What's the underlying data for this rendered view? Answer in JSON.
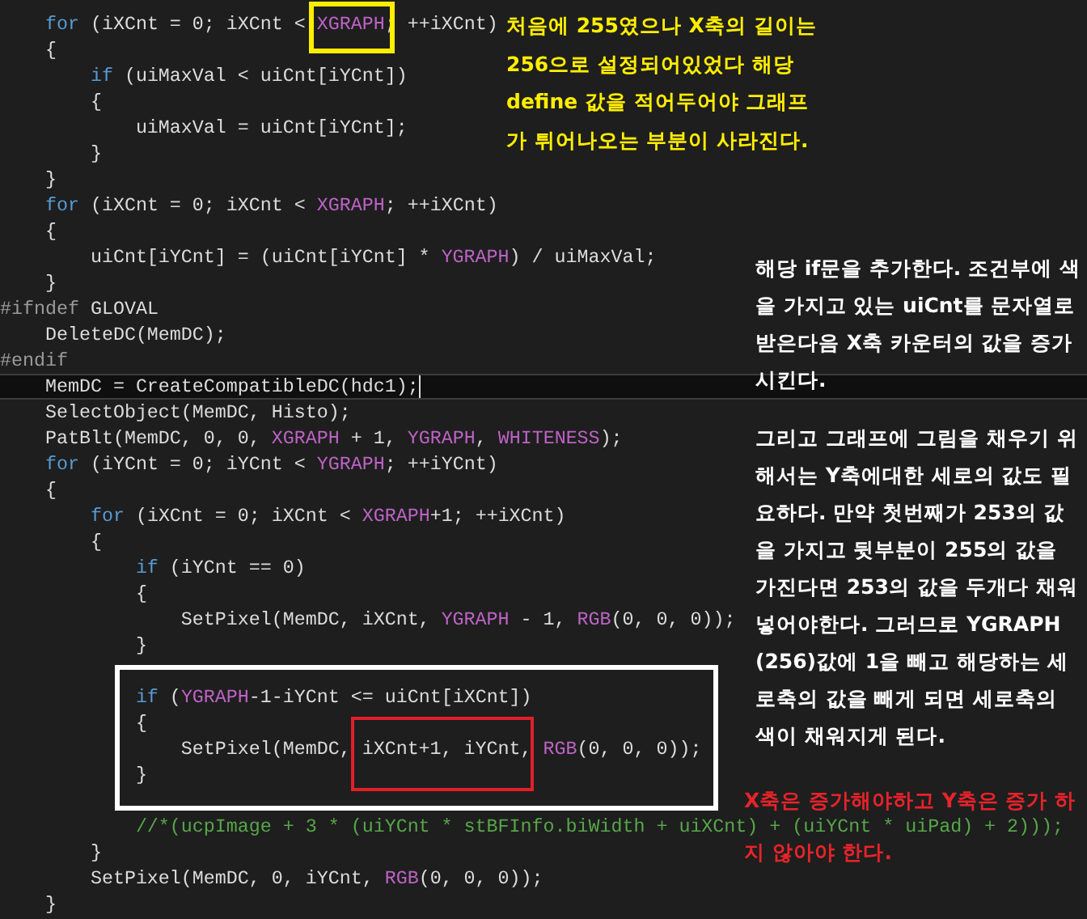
{
  "code_lines": [
    {
      "current": false,
      "tokens": [
        {
          "text": "    for",
          "kind": "keyword"
        },
        {
          "text": " (iXCnt = 0; iXCnt < ",
          "kind": "plain"
        },
        {
          "text": "XGRAPH",
          "kind": "macro"
        },
        {
          "text": "; ++iXCnt)",
          "kind": "plain"
        }
      ]
    },
    {
      "current": false,
      "tokens": [
        {
          "text": "    {",
          "kind": "plain"
        }
      ]
    },
    {
      "current": false,
      "tokens": [
        {
          "text": "        if",
          "kind": "keyword"
        },
        {
          "text": " (uiMaxVal < uiCnt[iYCnt])",
          "kind": "plain"
        }
      ]
    },
    {
      "current": false,
      "tokens": [
        {
          "text": "        {",
          "kind": "plain"
        }
      ]
    },
    {
      "current": false,
      "tokens": [
        {
          "text": "            uiMaxVal = uiCnt[iYCnt];",
          "kind": "plain"
        }
      ]
    },
    {
      "current": false,
      "tokens": [
        {
          "text": "        }",
          "kind": "plain"
        }
      ]
    },
    {
      "current": false,
      "tokens": [
        {
          "text": "    }",
          "kind": "plain"
        }
      ]
    },
    {
      "current": false,
      "tokens": [
        {
          "text": "    for",
          "kind": "keyword"
        },
        {
          "text": " (iXCnt = 0; iXCnt < ",
          "kind": "plain"
        },
        {
          "text": "XGRAPH",
          "kind": "macro"
        },
        {
          "text": "; ++iXCnt)",
          "kind": "plain"
        }
      ]
    },
    {
      "current": false,
      "tokens": [
        {
          "text": "    {",
          "kind": "plain"
        }
      ]
    },
    {
      "current": false,
      "tokens": [
        {
          "text": "        uiCnt[iYCnt] = (uiCnt[iYCnt] * ",
          "kind": "plain"
        },
        {
          "text": "YGRAPH",
          "kind": "macro"
        },
        {
          "text": ") / uiMaxVal;",
          "kind": "plain"
        }
      ]
    },
    {
      "current": false,
      "tokens": [
        {
          "text": "    }",
          "kind": "plain"
        }
      ]
    },
    {
      "current": false,
      "tokens": [
        {
          "text": "#ifndef",
          "kind": "preproc"
        },
        {
          "text": " GLOVAL",
          "kind": "plain"
        }
      ]
    },
    {
      "current": false,
      "tokens": [
        {
          "text": "    DeleteDC(MemDC);",
          "kind": "plain"
        }
      ]
    },
    {
      "current": false,
      "tokens": [
        {
          "text": "#endif",
          "kind": "preproc"
        }
      ]
    },
    {
      "current": true,
      "tokens": [
        {
          "text": "    MemDC = CreateCompatibleDC(hdc1);",
          "kind": "plain"
        }
      ]
    },
    {
      "current": false,
      "tokens": [
        {
          "text": "    SelectObject(MemDC, Histo);",
          "kind": "plain"
        }
      ]
    },
    {
      "current": false,
      "tokens": [
        {
          "text": "    PatBlt(MemDC, 0, 0, ",
          "kind": "plain"
        },
        {
          "text": "XGRAPH",
          "kind": "macro"
        },
        {
          "text": " + 1, ",
          "kind": "plain"
        },
        {
          "text": "YGRAPH",
          "kind": "macro"
        },
        {
          "text": ", ",
          "kind": "plain"
        },
        {
          "text": "WHITENESS",
          "kind": "macro"
        },
        {
          "text": ");",
          "kind": "plain"
        }
      ]
    },
    {
      "current": false,
      "tokens": [
        {
          "text": "    for",
          "kind": "keyword"
        },
        {
          "text": " (iYCnt = 0; iYCnt < ",
          "kind": "plain"
        },
        {
          "text": "YGRAPH",
          "kind": "macro"
        },
        {
          "text": "; ++iYCnt)",
          "kind": "plain"
        }
      ]
    },
    {
      "current": false,
      "tokens": [
        {
          "text": "    {",
          "kind": "plain"
        }
      ]
    },
    {
      "current": false,
      "tokens": [
        {
          "text": "        for",
          "kind": "keyword"
        },
        {
          "text": " (iXCnt = 0; iXCnt < ",
          "kind": "plain"
        },
        {
          "text": "XGRAPH",
          "kind": "macro"
        },
        {
          "text": "+1; ++iXCnt)",
          "kind": "plain"
        }
      ]
    },
    {
      "current": false,
      "tokens": [
        {
          "text": "        {",
          "kind": "plain"
        }
      ]
    },
    {
      "current": false,
      "tokens": [
        {
          "text": "            if",
          "kind": "keyword"
        },
        {
          "text": " (iYCnt == 0)",
          "kind": "plain"
        }
      ]
    },
    {
      "current": false,
      "tokens": [
        {
          "text": "            {",
          "kind": "plain"
        }
      ]
    },
    {
      "current": false,
      "tokens": [
        {
          "text": "                SetPixel(MemDC, iXCnt, ",
          "kind": "plain"
        },
        {
          "text": "YGRAPH",
          "kind": "macro"
        },
        {
          "text": " - 1, ",
          "kind": "plain"
        },
        {
          "text": "RGB",
          "kind": "macro"
        },
        {
          "text": "(0, 0, 0));",
          "kind": "plain"
        }
      ]
    },
    {
      "current": false,
      "tokens": [
        {
          "text": "            }",
          "kind": "plain"
        }
      ]
    },
    {
      "current": false
    },
    {
      "current": false,
      "tokens": [
        {
          "text": "            if",
          "kind": "keyword"
        },
        {
          "text": " (",
          "kind": "plain"
        },
        {
          "text": "YGRAPH",
          "kind": "macro"
        },
        {
          "text": "-1-iYCnt <= uiCnt[iXCnt])",
          "kind": "plain"
        }
      ]
    },
    {
      "current": false,
      "tokens": [
        {
          "text": "            {",
          "kind": "plain"
        }
      ]
    },
    {
      "current": false,
      "tokens": [
        {
          "text": "                SetPixel(MemDC, iXCnt+1, iYCnt, ",
          "kind": "plain"
        },
        {
          "text": "RGB",
          "kind": "macro"
        },
        {
          "text": "(0, 0, 0));",
          "kind": "plain"
        }
      ]
    },
    {
      "current": false,
      "tokens": [
        {
          "text": "            }",
          "kind": "plain"
        }
      ]
    },
    {
      "current": false
    },
    {
      "current": false,
      "tokens": [
        {
          "text": "            //*(ucpImage + 3 * (uiYCnt * stBFInfo.biWidth + uiXCnt) + (uiYCnt * uiPad) + 2)));",
          "kind": "comment"
        }
      ]
    },
    {
      "current": false,
      "tokens": [
        {
          "text": "        }",
          "kind": "plain"
        }
      ]
    },
    {
      "current": false,
      "tokens": [
        {
          "text": "        SetPixel(MemDC, 0, iYCnt, ",
          "kind": "plain"
        },
        {
          "text": "RGB",
          "kind": "macro"
        },
        {
          "text": "(0, 0, 0));",
          "kind": "plain"
        }
      ]
    },
    {
      "current": false,
      "tokens": [
        {
          "text": "    }",
          "kind": "plain"
        }
      ]
    }
  ],
  "highlight_frames": [
    {
      "color": "#ffee00"
    },
    {
      "color": "#ffffff"
    },
    {
      "color": "#e0202a"
    }
  ],
  "notes": [
    {
      "color": "#ffee00",
      "paragraphs": [
        [
          "처음에 255였으나 X축의 길이는",
          "256으로 설정되어있었다 해당",
          "define 값을 적어두어야 그래프",
          "가 튀어나오는 부분이 사라진다."
        ]
      ]
    },
    {
      "color": "#ffffff",
      "paragraphs": [
        [
          "해당 if문을 추가한다. 조건부에 색",
          "을 가지고 있는 uiCnt를 문자열로",
          "받은다음 X축 카운터의 값을 증가",
          "시킨다."
        ],
        [
          "그리고 그래프에 그림을 채우기 위",
          "해서는 Y축에대한 세로의 값도 필",
          "요하다. 만약 첫번째가 253의 값",
          "을 가지고 뒷부분이 255의 값을",
          "가진다면 253의 값을 두개다 채워",
          "넣어야한다. 그러므로 YGRAPH",
          "(256)값에 1을 빼고 해당하는 세",
          "로축의 값을 빼게 되면 세로축의",
          "색이 채워지게 된다."
        ]
      ]
    },
    {
      "color": "#e8232a",
      "paragraphs": [
        [
          "X축은 증가해야하고 Y축은 증가 하",
          "지 않아야 한다."
        ]
      ]
    }
  ]
}
